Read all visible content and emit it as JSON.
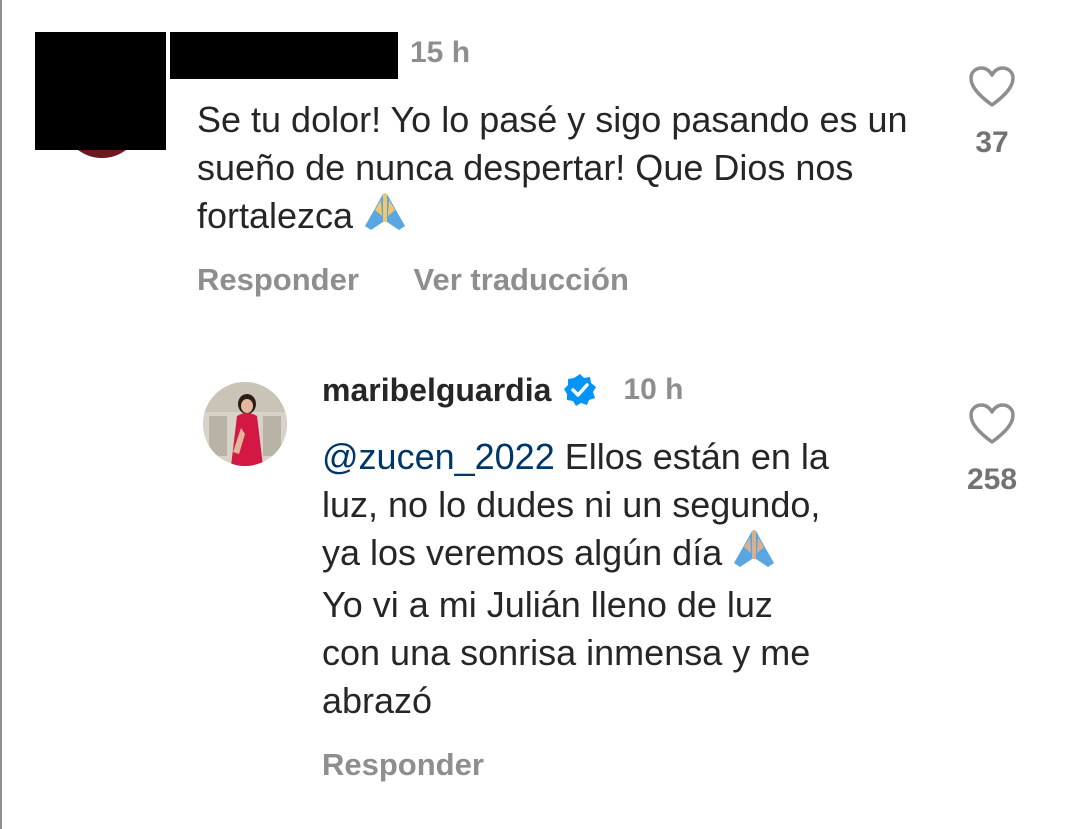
{
  "comment1": {
    "time": "15 h",
    "text": "Se tu dolor! Yo lo pasé y sigo pasando es un sueño de nunca despertar! Que Dios nos fortalezca",
    "likes": "37",
    "actions": {
      "reply": "Responder",
      "translate": "Ver traducción"
    }
  },
  "reply1": {
    "username": "maribelguardia",
    "verified": true,
    "time": "10 h",
    "mention": "@zucen_2022",
    "text_line1_rest": " Ellos están en la",
    "text_line2": "luz, no lo dudes ni un segundo,",
    "text_line3": "ya los veremos algún día",
    "text_line4": "Yo vi a mi Julián lleno de luz",
    "text_line5": "con una sonrisa inmensa y me",
    "text_line6": "abrazó",
    "likes": "258",
    "actions": {
      "reply": "Responder"
    }
  },
  "icons": {
    "like": "heart-outline-icon",
    "verified": "verified-badge-icon",
    "emoji": "folded-hands-emoji"
  },
  "colors": {
    "text": "#262626",
    "muted": "#8e8e8e",
    "mention": "#00376b",
    "verified": "#0095f6"
  }
}
